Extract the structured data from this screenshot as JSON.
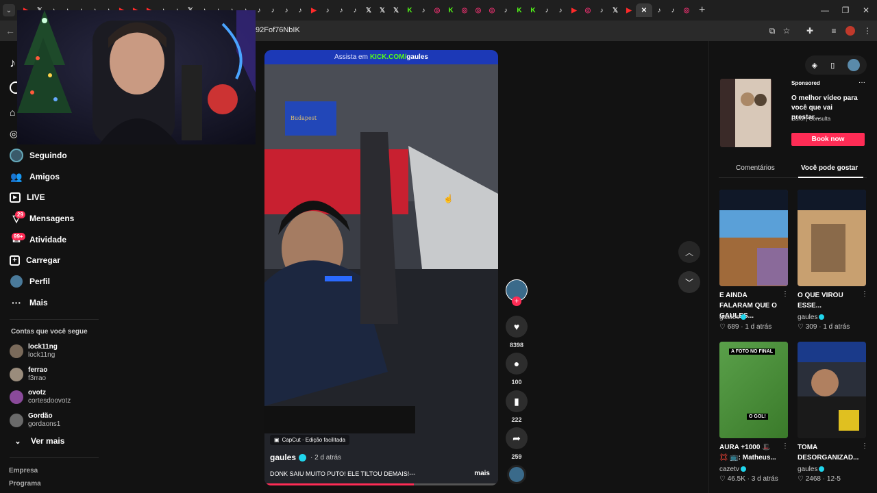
{
  "browser": {
    "url": "92Fof76NbIK",
    "tab_icons": [
      "yt",
      "x",
      "tt",
      "tt",
      "tt",
      "tt",
      "tt",
      "yt",
      "yt",
      "yt",
      "tt",
      "tt",
      "x",
      "tt",
      "tt",
      "tt",
      "tt",
      "tt",
      "tt",
      "tt",
      "tt",
      "yt",
      "tt",
      "tt",
      "tt",
      "x",
      "x",
      "x",
      "kick",
      "tt",
      "ig",
      "kick",
      "ig",
      "ig",
      "ig",
      "tt",
      "kick",
      "kick",
      "tt",
      "tt",
      "yt",
      "ig",
      "tt",
      "x",
      "yt"
    ],
    "active_tab_close": "✕",
    "new_tab": "+"
  },
  "sidebar": {
    "items": [
      {
        "label": "Seguindo",
        "icon": "following-avatar-icon"
      },
      {
        "label": "Amigos",
        "icon": "friends-icon"
      },
      {
        "label": "LIVE",
        "icon": "live-icon"
      },
      {
        "label": "Mensagens",
        "icon": "messages-icon",
        "badge": "29"
      },
      {
        "label": "Atividade",
        "icon": "activity-icon",
        "badge": "99+"
      },
      {
        "label": "Carregar",
        "icon": "upload-icon"
      },
      {
        "label": "Perfil",
        "icon": "profile-icon"
      },
      {
        "label": "Mais",
        "icon": "more-icon"
      }
    ],
    "following_title": "Contas que você segue",
    "accounts": [
      {
        "name": "lock11ng",
        "handle": "lock11ng",
        "color": "#7a6a5a"
      },
      {
        "name": "ferrao",
        "handle": "f3rrao",
        "color": "#9a8c7c"
      },
      {
        "name": "ovotz",
        "handle": "cortesdoovotz",
        "color": "#8a4a9a"
      },
      {
        "name": "Gordão",
        "handle": "gordaons1",
        "color": "#6a6a6a"
      }
    ],
    "see_more": "Ver mais",
    "footer": [
      "Empresa",
      "Programa"
    ]
  },
  "video": {
    "banner_prefix": "Assista em",
    "banner_brand": "KICK.COM/",
    "banner_channel": "gaules",
    "sign": "Budapest",
    "capcut": "CapCut · Edição facilitada",
    "author": "gaules",
    "time": "· 2 d atrás",
    "caption": "DONK SAIU MUITO PUTO! ELE TILTOU DEMAIS!---",
    "more": "mais",
    "progress": 0.64
  },
  "actions": {
    "likes": "8398",
    "comments": "100",
    "saves": "222",
    "shares": "259"
  },
  "right_panel": {
    "sponsored_label": "Sponsored",
    "ad_title": "O melhor vídeo para você que vai prestar...",
    "ad_author": "Carol | Consulta",
    "ad_button": "Book now",
    "tab_comments": "Comentários",
    "tab_suggest": "Você pode gostar",
    "cards": [
      {
        "title": "E AINDA FALARAM QUE O GAULES...",
        "author": "gaules",
        "likes": "689",
        "time": "1 d atrás"
      },
      {
        "title": "O QUE VIROU ESSE...",
        "author": "gaules",
        "likes": "309",
        "time": "1 d atrás"
      },
      {
        "title": "AURA +1000 🎩 💢 📺: Matheus...",
        "author": "cazetv",
        "likes": "46.5K",
        "time": "3 d atrás"
      },
      {
        "title": "TOMA DESORGANIZAD...",
        "author": "gaules",
        "likes": "2468",
        "time": "12-5"
      }
    ],
    "thumb_labels": [
      "A FOTO NO FINAL",
      "O GOL!"
    ]
  }
}
